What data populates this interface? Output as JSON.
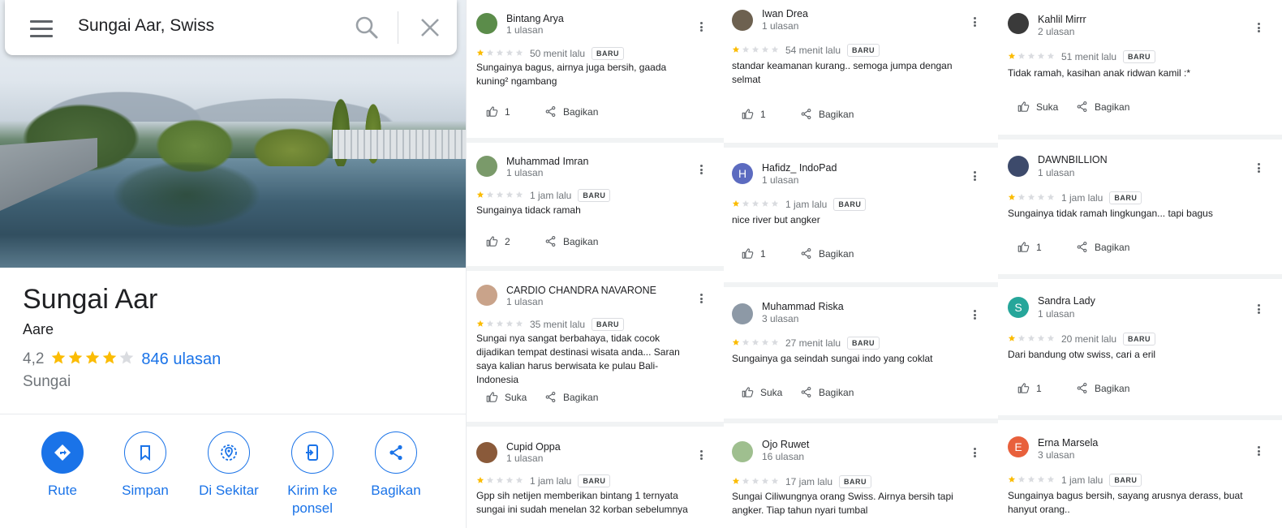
{
  "search": {
    "query": "Sungai Aar, Swiss"
  },
  "place": {
    "title": "Sungai Aar",
    "subtitle": "Aare",
    "rating": "4,2",
    "rating_stars": 4,
    "reviews_link": "846 ulasan",
    "category": "Sungai"
  },
  "actions": [
    {
      "label": "Rute",
      "icon": "directions-icon"
    },
    {
      "label": "Simpan",
      "icon": "bookmark-icon"
    },
    {
      "label": "Di Sekitar",
      "icon": "nearby-icon"
    },
    {
      "label": "Kirim ke ponsel",
      "icon": "phone-icon"
    },
    {
      "label": "Bagikan",
      "icon": "share-icon"
    }
  ],
  "colors": {
    "accent": "#1a73e8",
    "star": "#fbbc04",
    "star_empty": "#dadce0"
  },
  "badge_label": "BARU",
  "share_label": "Bagikan",
  "reviews": [
    {
      "name": "Bintang Arya",
      "count": "1 ulasan",
      "time": "50 menit lalu",
      "stars": 1,
      "text": "Sungainya bagus, airnya juga bersih, gaada kuning² ngambang",
      "like": "1",
      "avatar_color": "#5b8c4a",
      "avatar_letter": ""
    },
    {
      "name": "Muhammad Imran",
      "count": "1 ulasan",
      "time": "1 jam lalu",
      "stars": 1,
      "text": "Sungainya tidack ramah",
      "like": "2",
      "avatar_color": "#7a9a6a",
      "avatar_letter": ""
    },
    {
      "name": "CARDIO CHANDRA NAVARONE",
      "count": "1 ulasan",
      "time": "35 menit lalu",
      "stars": 1,
      "text": "Sungai nya sangat berbahaya, tidak cocok dijadikan tempat destinasi wisata anda... Saran saya kalian harus berwisata ke pulau Bali-Indonesia",
      "like": "Suka",
      "avatar_color": "#c9a38a",
      "avatar_letter": ""
    },
    {
      "name": "Cupid Oppa",
      "count": "1 ulasan",
      "time": "1 jam lalu",
      "stars": 1,
      "text": "Gpp sih netijen memberikan bintang 1 ternyata sungai ini sudah menelan 32 korban sebelumnya",
      "like": "",
      "avatar_color": "#8a5a3a",
      "avatar_letter": ""
    },
    {
      "name": "Iwan Drea",
      "count": "1 ulasan",
      "time": "54 menit lalu",
      "stars": 1,
      "text": "standar keamanan kurang.. semoga jumpa dengan selmat",
      "like": "1",
      "avatar_color": "#6d6150",
      "avatar_letter": ""
    },
    {
      "name": "Hafidz_ IndoPad",
      "count": "1 ulasan",
      "time": "1 jam lalu",
      "stars": 1,
      "text": "nice river but angker",
      "like": "1",
      "avatar_color": "#5c6bc0",
      "avatar_letter": "H"
    },
    {
      "name": "Muhammad Riska",
      "count": "3 ulasan",
      "time": "27 menit lalu",
      "stars": 1,
      "text": "Sungainya ga seindah sungai indo yang coklat",
      "like": "Suka",
      "avatar_color": "#8d99a6",
      "avatar_letter": ""
    },
    {
      "name": "Ojo Ruwet",
      "count": "16 ulasan",
      "time": "17 jam lalu",
      "stars": 1,
      "text": "Sungai Ciliwungnya orang Swiss. Airnya bersih tapi angker. Tiap tahun nyari tumbal",
      "like": "",
      "avatar_color": "#9fbf8f",
      "avatar_letter": ""
    },
    {
      "name": "Kahlil Mirrr",
      "count": "2 ulasan",
      "time": "51 menit lalu",
      "stars": 1,
      "text": "Tidak ramah, kasihan anak ridwan kamil :*",
      "like": "Suka",
      "avatar_color": "#3a3a3a",
      "avatar_letter": ""
    },
    {
      "name": "DAWNBILLION",
      "count": "1 ulasan",
      "time": "1 jam lalu",
      "stars": 1,
      "text": "Sungainya tidak ramah lingkungan... tapi bagus",
      "like": "1",
      "avatar_color": "#3d4a6b",
      "avatar_letter": ""
    },
    {
      "name": "Sandra Lady",
      "count": "1 ulasan",
      "time": "20 menit lalu",
      "stars": 1,
      "text": "Dari bandung otw swiss, cari a eril",
      "like": "1",
      "avatar_color": "#26a69a",
      "avatar_letter": "S"
    },
    {
      "name": "Erna Marsela",
      "count": "3 ulasan",
      "time": "1 jam lalu",
      "stars": 1,
      "text": "Sungainya bagus bersih, sayang arusnya derass, buat hanyut orang..",
      "like": "",
      "avatar_color": "#e8603c",
      "avatar_letter": "E"
    }
  ]
}
